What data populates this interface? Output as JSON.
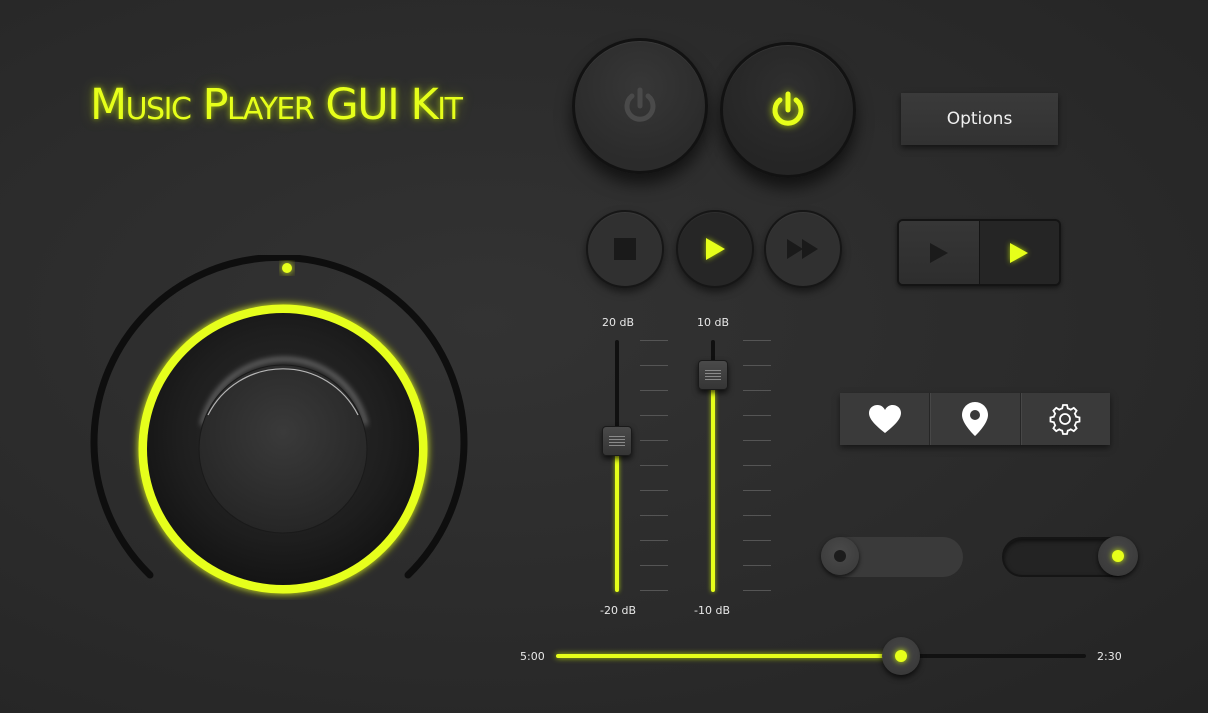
{
  "title": "Music Player GUI Kit",
  "colors": {
    "accent": "#e6ff1a",
    "background": "#2b2b2b",
    "panel": "#3a3a3a",
    "inactive_icon": "#4a4a4a"
  },
  "knob": {
    "icon": "volume-knob",
    "level": 1.0
  },
  "power": {
    "off_icon": "power-icon",
    "on_icon": "power-icon",
    "off_state": "off",
    "on_state": "on"
  },
  "options_label": "Options",
  "transport": {
    "stop_icon": "stop-icon",
    "play_icon": "play-icon",
    "fast_forward_icon": "fast-forward-icon"
  },
  "play_toggle": {
    "left_icon": "play-icon",
    "right_icon": "play-icon",
    "active": "right"
  },
  "faders": [
    {
      "top_label": "20 dB",
      "bottom_label": "-20 dB",
      "level": 0.6
    },
    {
      "top_label": "10 dB",
      "bottom_label": "-10 dB",
      "level": 0.86
    }
  ],
  "icon_bar": [
    "heart-icon",
    "location-pin-icon",
    "gear-icon"
  ],
  "toggles": [
    {
      "state": "off"
    },
    {
      "state": "on"
    }
  ],
  "progress": {
    "start_label": "5:00",
    "end_label": "2:30",
    "fraction": 0.65
  }
}
